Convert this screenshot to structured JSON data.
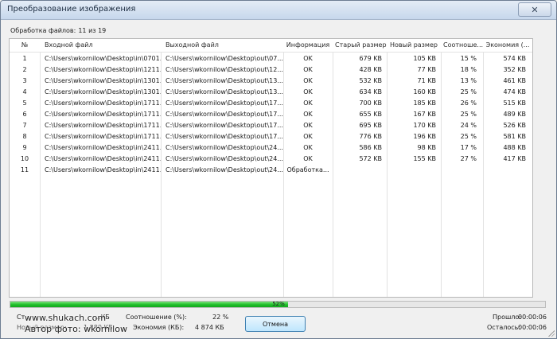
{
  "window": {
    "title": "Преобразование изображения",
    "close_glyph": "✕"
  },
  "counter": {
    "label": "Обработка файлов:",
    "value": "11 из 19"
  },
  "table": {
    "columns": [
      "№",
      "Входной файл",
      "Выходной файл",
      "Информация",
      "Старый размер",
      "Новый размер",
      "Соотноше...",
      "Экономия (..."
    ],
    "rows": [
      [
        "1",
        "C:\\Users\\wkornilow\\Desktop\\in\\0701...",
        "C:\\Users\\wkornilow\\Desktop\\out\\07...",
        "OK",
        "679 KB",
        "105 KB",
        "15 %",
        "574 KB"
      ],
      [
        "2",
        "C:\\Users\\wkornilow\\Desktop\\in\\1211...",
        "C:\\Users\\wkornilow\\Desktop\\out\\12...",
        "OK",
        "428 KB",
        "77 KB",
        "18 %",
        "352 KB"
      ],
      [
        "3",
        "C:\\Users\\wkornilow\\Desktop\\in\\1301...",
        "C:\\Users\\wkornilow\\Desktop\\out\\13...",
        "OK",
        "532 KB",
        "71 KB",
        "13 %",
        "461 KB"
      ],
      [
        "4",
        "C:\\Users\\wkornilow\\Desktop\\in\\1301...",
        "C:\\Users\\wkornilow\\Desktop\\out\\13...",
        "OK",
        "634 KB",
        "160 KB",
        "25 %",
        "474 KB"
      ],
      [
        "5",
        "C:\\Users\\wkornilow\\Desktop\\in\\1711...",
        "C:\\Users\\wkornilow\\Desktop\\out\\17...",
        "OK",
        "700 KB",
        "185 KB",
        "26 %",
        "515 KB"
      ],
      [
        "6",
        "C:\\Users\\wkornilow\\Desktop\\in\\1711...",
        "C:\\Users\\wkornilow\\Desktop\\out\\17...",
        "OK",
        "655 KB",
        "167 KB",
        "25 %",
        "489 KB"
      ],
      [
        "7",
        "C:\\Users\\wkornilow\\Desktop\\in\\1711...",
        "C:\\Users\\wkornilow\\Desktop\\out\\17...",
        "OK",
        "695 KB",
        "170 KB",
        "24 %",
        "526 KB"
      ],
      [
        "8",
        "C:\\Users\\wkornilow\\Desktop\\in\\1711...",
        "C:\\Users\\wkornilow\\Desktop\\out\\17...",
        "OK",
        "776 KB",
        "196 KB",
        "25 %",
        "581 KB"
      ],
      [
        "9",
        "C:\\Users\\wkornilow\\Desktop\\in\\2411...",
        "C:\\Users\\wkornilow\\Desktop\\out\\24...",
        "OK",
        "586 KB",
        "98 KB",
        "17 %",
        "488 KB"
      ],
      [
        "10",
        "C:\\Users\\wkornilow\\Desktop\\in\\2411...",
        "C:\\Users\\wkornilow\\Desktop\\out\\24...",
        "OK",
        "572 KB",
        "155 KB",
        "27 %",
        "417 KB"
      ],
      [
        "11",
        "C:\\Users\\wkornilow\\Desktop\\in\\2411...",
        "C:\\Users\\wkornilow\\Desktop\\out\\24...",
        "Обработка...",
        "",
        "",
        "",
        ""
      ]
    ]
  },
  "progress": {
    "percent": 52,
    "label": "52%"
  },
  "stats": {
    "old_label": "Ст...",
    "old_value": "...КБ",
    "new_label": "Новый размер:",
    "new_value": "1 880 КБ",
    "ratio_label": "Соотношение (%):",
    "ratio_value": "22 %",
    "savings_label": "Экономия (КБ):",
    "savings_value": "4 874 КБ",
    "elapsed_label": "Прошло:",
    "elapsed_value": "00:00:06",
    "remaining_label": "Осталось:",
    "remaining_value": "00:00:06"
  },
  "cancel_label": "Отмена",
  "watermark": {
    "site": "www.shukach.com",
    "author": "Автор фото: wkornilow"
  },
  "colors": {
    "progress": "#1fbf2a",
    "accent": "#3c7fb1",
    "titlebar": "#c6d7ec"
  }
}
